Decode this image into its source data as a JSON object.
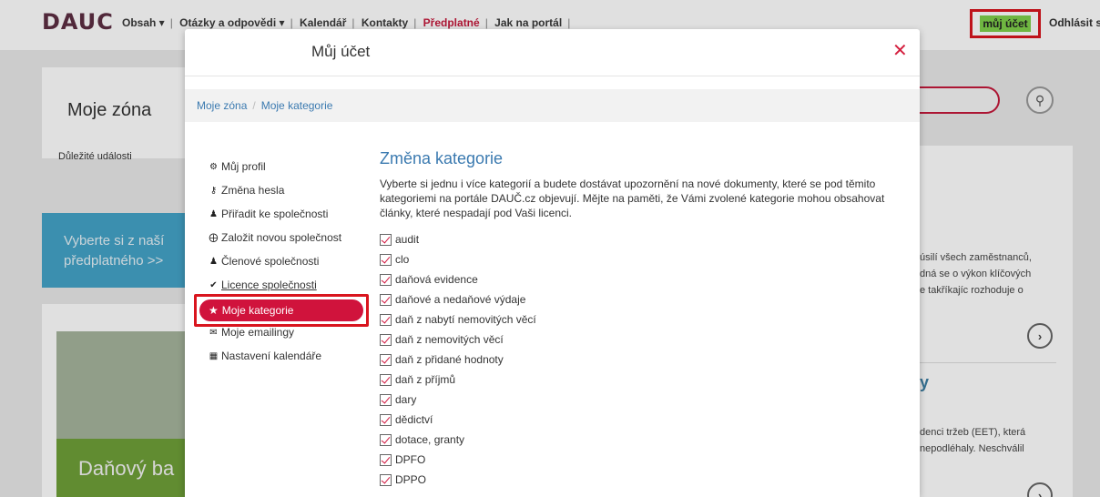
{
  "topbar": {
    "logo": "DAUC",
    "nav": [
      {
        "label": "Obsah ▾"
      },
      {
        "label": "Otázky a odpovědi ▾"
      },
      {
        "label": "Kalendář"
      },
      {
        "label": "Kontakty"
      },
      {
        "label": "Předplatné"
      },
      {
        "label": "Jak na portál"
      }
    ],
    "account_label": "můj účet",
    "logout_label": "Odhlásit s",
    "accent_color": "#c4193b"
  },
  "background": {
    "zone_heading": "Moje zóna",
    "important_events": "Důležité události",
    "promo_text_1": "Vyberte si z naší",
    "promo_text_2": "předplatného >>",
    "promo_banner": "Daňový ba",
    "right_text_1": "úsilí všech zaměstnanců,",
    "right_text_2": "dná se o výkon klíčových",
    "right_text_3": "e takříkajíc rozhoduje o",
    "right_heading": "y",
    "right_text_4": "denci tržeb (EET), která",
    "right_text_5": "nepodléhaly. Neschválil"
  },
  "modal": {
    "title": "Můj účet",
    "close_icon": "close-icon",
    "breadcrumb": {
      "home": "Moje zóna",
      "current": "Moje kategorie"
    },
    "menu": [
      {
        "icon": "gear-icon",
        "label": "Můj profil"
      },
      {
        "icon": "key-icon",
        "label": "Změna hesla"
      },
      {
        "icon": "users-icon",
        "label": "Přiřadit ke společnosti"
      },
      {
        "icon": "plus-circle-icon",
        "label": "Založit novou společnost"
      },
      {
        "icon": "group-icon",
        "label": "Členové společnosti"
      },
      {
        "icon": "check-icon",
        "label": "Licence společnosti"
      },
      {
        "icon": "star-icon",
        "label": "Moje kategorie",
        "active": true
      },
      {
        "icon": "envelope-icon",
        "label": "Moje emailingy"
      },
      {
        "icon": "calendar-icon",
        "label": "Nastavení kalendáře"
      }
    ],
    "content": {
      "heading": "Změna kategorie",
      "description": "Vyberte si jednu i více kategorií a budete dostávat upozornění na nové dokumenty, které se pod těmito kategoriemi na portále DAUČ.cz objevují. Mějte na paměti, že Vámi zvolené kategorie mohou obsahovat články, které nespadají pod Vaši licenci.",
      "categories": [
        {
          "label": "audit",
          "checked": true
        },
        {
          "label": "clo",
          "checked": true
        },
        {
          "label": "daňová evidence",
          "checked": true
        },
        {
          "label": "daňové a nedaňové výdaje",
          "checked": true
        },
        {
          "label": "daň z nabytí nemovitých věcí",
          "checked": true
        },
        {
          "label": "daň z nemovitých věcí",
          "checked": true
        },
        {
          "label": "daň z přidané hodnoty",
          "checked": true
        },
        {
          "label": "daň z příjmů",
          "checked": true
        },
        {
          "label": "dary",
          "checked": true
        },
        {
          "label": "dědictví",
          "checked": true
        },
        {
          "label": "dotace, granty",
          "checked": true
        },
        {
          "label": "DPFO",
          "checked": true
        },
        {
          "label": "DPPO",
          "checked": true
        }
      ]
    },
    "active_color": "#d0133c",
    "link_color": "#3b7ab0"
  }
}
